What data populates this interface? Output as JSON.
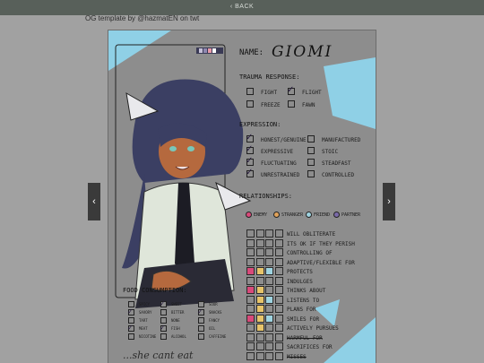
{
  "header": {
    "back_label": "‹ BACK"
  },
  "credit": "OG template by @hazmatEN on twt",
  "sheet": {
    "name_label": "NAME:",
    "name_value": "GIOMI",
    "trauma": {
      "title": "TRAUMA RESPONSE:",
      "items": [
        {
          "label": "FIGHT",
          "checked": false
        },
        {
          "label": "FLIGHT",
          "checked": true
        },
        {
          "label": "FREEZE",
          "checked": false
        },
        {
          "label": "FAWN",
          "checked": false
        }
      ]
    },
    "expression": {
      "title": "EXPRESSION:",
      "left": [
        {
          "label": "HONEST/GENUINE",
          "checked": true
        },
        {
          "label": "EXPRESSIVE",
          "checked": true
        },
        {
          "label": "FLUCTUATING",
          "checked": true
        },
        {
          "label": "UNRESTRAINED",
          "checked": true
        }
      ],
      "right": [
        {
          "label": "MANUFACTURED",
          "checked": false
        },
        {
          "label": "STOIC",
          "checked": false
        },
        {
          "label": "STEADFAST",
          "checked": false
        },
        {
          "label": "CONTROLLED",
          "checked": false
        }
      ]
    },
    "relationships": {
      "title": "RELATIONSHIPS:",
      "legend": [
        {
          "label": "ENEMY",
          "color": "#d94a7a"
        },
        {
          "label": "STRANGER",
          "color": "#e0a25a"
        },
        {
          "label": "FRIEND",
          "color": "#9fd3e0"
        },
        {
          "label": "PARTNER",
          "color": "#7a6aa8"
        }
      ],
      "rows": [
        "WILL OBLITERATE",
        "ITS OK IF THEY PERISH",
        "CONTROLLING OF",
        "ADAPTIVE/FLEXIBLE FOR",
        "PROTECTS",
        "INDULGES",
        "THINKS ABOUT",
        "LISTENS TO",
        "PLANS FOR",
        "SMILES FOR",
        "ACTIVELY PURSUES",
        "HARMFUL FOR",
        "SACRIFICES FOR",
        "MISSES"
      ]
    },
    "food": {
      "title": "FOOD CONSUMPTION:",
      "col1": [
        {
          "label": "SPICY",
          "checked": false
        },
        {
          "label": "SAVORY",
          "checked": true
        },
        {
          "label": "TART",
          "checked": false
        },
        {
          "label": "MEAT",
          "checked": true
        },
        {
          "label": "NICOTINE",
          "checked": false
        }
      ],
      "col2": [
        {
          "label": "SWEET",
          "checked": true
        },
        {
          "label": "BITTER",
          "checked": false
        },
        {
          "label": "NONE",
          "checked": false
        },
        {
          "label": "FISH",
          "checked": true
        },
        {
          "label": "ALCOHOL",
          "checked": false
        }
      ],
      "col3": [
        {
          "label": "SOUR",
          "checked": false
        },
        {
          "label": "SNACKS",
          "checked": true
        },
        {
          "label": "FANCY",
          "checked": false
        },
        {
          "label": "OIL",
          "checked": false
        },
        {
          "label": "CAFFEINE",
          "checked": false
        }
      ]
    },
    "handwriting": "...she cant eat",
    "colors": {
      "accent_blue": "#8fd0e6",
      "sheet_bg": "#8d8d8d",
      "pink": "#d94a7a",
      "yellow": "#e7c46a"
    }
  },
  "nav": {
    "prev": "‹",
    "next": "›"
  }
}
